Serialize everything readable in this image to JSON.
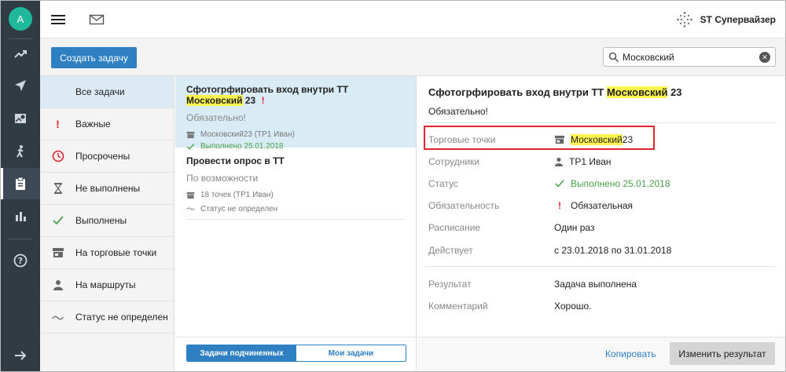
{
  "user": {
    "avatar_letter": "A"
  },
  "header": {
    "brand": "ST Супервайзер"
  },
  "toolbar": {
    "create_label": "Создать задачу",
    "search_value": "Московский",
    "search_placeholder": ""
  },
  "rail": {
    "icons": [
      "trend-icon",
      "navigation-icon",
      "map-icon",
      "walking-icon",
      "clipboard-icon",
      "bar-chart-icon",
      "help-icon",
      "logout-arrow-icon"
    ],
    "active": "clipboard-icon"
  },
  "filters": [
    {
      "label": "Все задачи",
      "icon": "none",
      "active": true
    },
    {
      "label": "Важные",
      "icon": "exclamation-icon"
    },
    {
      "label": "Просрочены",
      "icon": "clock-icon"
    },
    {
      "label": "Не выполнены",
      "icon": "hourglass-icon"
    },
    {
      "label": "Выполнены",
      "icon": "check-icon"
    },
    {
      "label": "На торговые точки",
      "icon": "store-icon"
    },
    {
      "label": "На маршруты",
      "icon": "person-icon"
    },
    {
      "label": "Статус не определен",
      "icon": "tilde-icon"
    }
  ],
  "tasks": [
    {
      "title_pre": "Сфотогрфировать вход внутри ТТ ",
      "title_hl": "Московский",
      "title_post": " 23",
      "important_mark": "!",
      "priority": "Обязательно!",
      "meta1": "Московский23 (ТР1 Иван)",
      "meta2": "Выполнено 25.01.2018"
    },
    {
      "title": "Провести опрос в ТТ",
      "priority": "По возможности",
      "meta1": "18 точек (ТР1 Иван)",
      "meta2": "Статус не определен"
    }
  ],
  "segment": {
    "subordinates": "Задачи подчиненных",
    "mine": "Мои задачи"
  },
  "detail": {
    "title_pre": "Сфотогрфировать вход внутри ТТ ",
    "title_hl": "Московский",
    "title_post": " 23",
    "priority": "Обязательно!",
    "fields": {
      "points": {
        "k": "Торговые точки",
        "v_hl": "Московский",
        "v_rest": "23"
      },
      "staff": {
        "k": "Сотрудники",
        "v": "ТР1 Иван"
      },
      "status": {
        "k": "Статус",
        "v": "Выполнено 25.01.2018"
      },
      "mandatory": {
        "k": "Обязательность",
        "mark": "!",
        "v": "Обязательная"
      },
      "schedule": {
        "k": "Расписание",
        "v": "Один раз"
      },
      "valid": {
        "k": "Действует",
        "v": "с 23.01.2018 по 31.01.2018"
      },
      "result": {
        "k": "Результат",
        "v": "Задача выполнена"
      },
      "comment": {
        "k": "Комментарий",
        "v": "Хорошо."
      }
    },
    "copy_label": "Копировать",
    "change_label": "Изменить результат"
  },
  "colors": {
    "accent": "#2f7fc3",
    "rail": "#303b44",
    "success": "#4aa14a",
    "danger": "#e0252e",
    "highlight": "#fff54f",
    "avatar": "#1fb89a"
  }
}
